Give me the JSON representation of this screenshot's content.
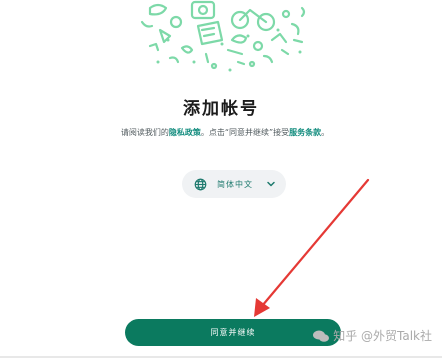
{
  "page": {
    "title": "添加帐号",
    "policy": {
      "prefix": "请阅读我们的",
      "privacy_link": "隐私政策",
      "middle": "。点击“同意并继续”接受",
      "terms_link": "服务条款",
      "suffix": "。"
    },
    "language": {
      "selected": "简体中文",
      "icon": "globe-icon",
      "chevron_icon": "chevron-down-icon"
    },
    "agree_button": {
      "label": "同意并继续"
    },
    "watermark": {
      "text": "知乎 @外贸Talk社",
      "icon": "wechat-icon"
    }
  },
  "colors": {
    "accent": "#0b7a5f",
    "link": "#128c7e",
    "illustration": "#7dd9a8",
    "arrow": "#e53935"
  }
}
